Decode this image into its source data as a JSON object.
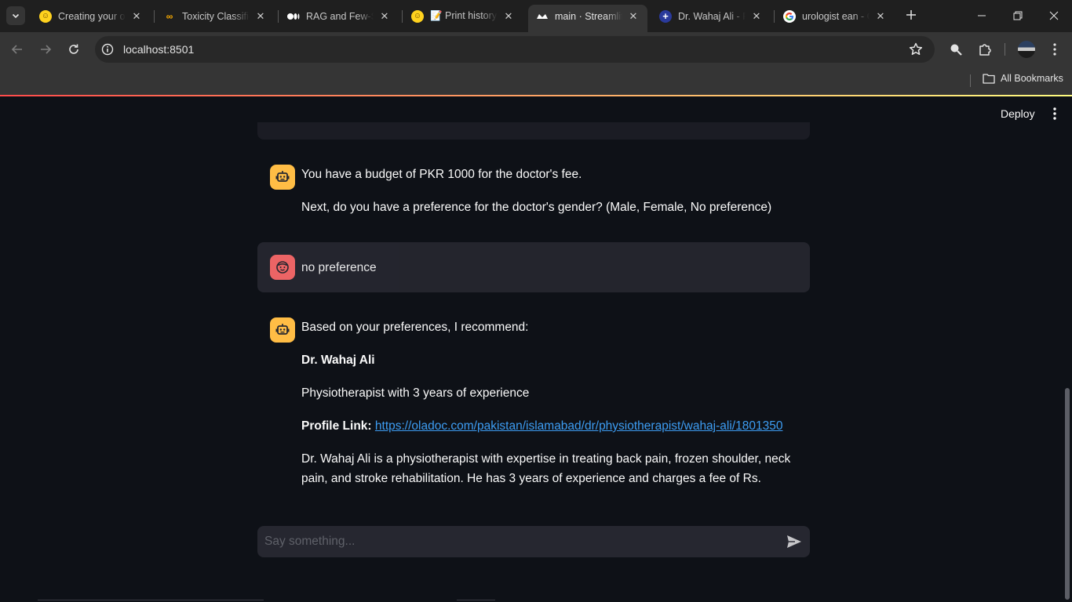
{
  "browser": {
    "tabs": [
      {
        "title": "Creating your ov",
        "favicon": "hugging-face-icon",
        "active": false
      },
      {
        "title": "Toxicity Classifier",
        "favicon": "colab-icon",
        "active": false
      },
      {
        "title": "RAG and Few-Sh",
        "favicon": "medium-icon",
        "active": false
      },
      {
        "title": "📝 Print history",
        "favicon": "hugging-face-icon",
        "active": false
      },
      {
        "title": "main · Streamlit",
        "favicon": "streamlit-icon",
        "active": true
      },
      {
        "title": "Dr. Wahaj Ali - P",
        "favicon": "oladoc-icon",
        "active": false
      },
      {
        "title": "urologist ean - G",
        "favicon": "google-icon",
        "active": false
      }
    ],
    "address": "localhost:8501",
    "bookmarks": {
      "all_label": "All Bookmarks"
    }
  },
  "app": {
    "header": {
      "deploy_label": "Deploy"
    },
    "messages": [
      {
        "role": "assistant",
        "paragraphs": [
          "You have a budget of PKR 1000 for the doctor's fee.",
          "Next, do you have a preference for the doctor's gender? (Male, Female, No preference)"
        ]
      },
      {
        "role": "user",
        "text": "no preference"
      },
      {
        "role": "assistant",
        "intro": "Based on your preferences, I recommend:",
        "doctor_name": "Dr. Wahaj Ali",
        "specialty": "Physiotherapist with 3 years of experience",
        "profile_label": "Profile Link:",
        "profile_url": "https://oladoc.com/pakistan/islamabad/dr/physiotherapist/wahaj-ali/1801350",
        "description": "Dr. Wahaj Ali is a physiotherapist with expertise in treating back pain, frozen shoulder, neck pain, and stroke rehabilitation. He has 3 years of experience and charges a fee of Rs."
      }
    ],
    "chat_input": {
      "placeholder": "Say something...",
      "value": ""
    }
  },
  "colors": {
    "app_bg": "#0e1117",
    "secondary_bg": "#262730",
    "assistant_avatar": "#ffbd45",
    "user_avatar": "#ff6c6c",
    "link": "#3d9df3",
    "decoration_start": "#ff4b4b",
    "decoration_end": "#fffd80"
  }
}
